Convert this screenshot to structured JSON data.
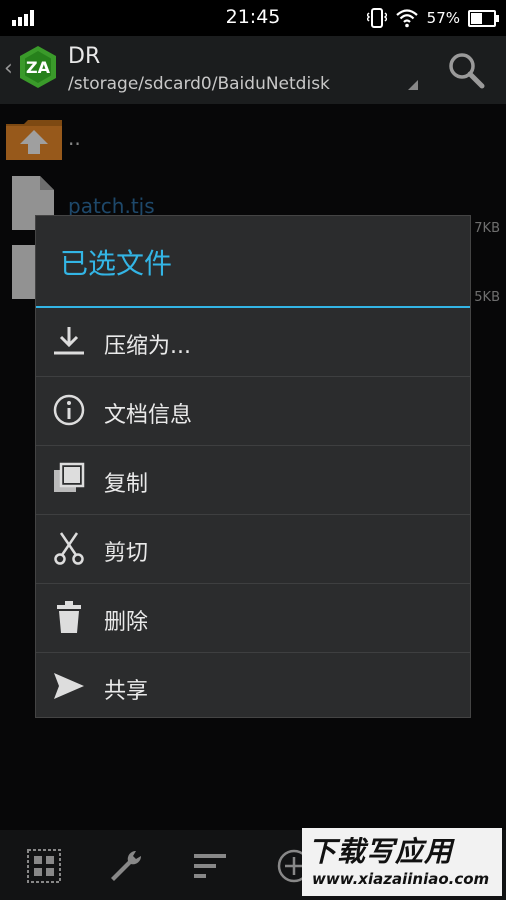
{
  "status_bar": {
    "time": "21:45",
    "battery_percent": "57%",
    "battery_level": 0.57,
    "icons": [
      "signal-icon",
      "vibrate-icon",
      "wifi-icon",
      "battery-icon"
    ]
  },
  "action_bar": {
    "title": "DR",
    "path": "/storage/sdcard0/BaiduNetdisk",
    "icons": [
      "back-chevron-icon",
      "zarchiver-logo-icon",
      "dropdown-triangle-icon",
      "search-icon"
    ]
  },
  "file_list": {
    "up_label": "..",
    "items": [
      {
        "name": "patch.tjs",
        "size": "7KB"
      },
      {
        "name": "",
        "size": "5KB"
      }
    ]
  },
  "dialog": {
    "title": "已选文件",
    "items": [
      {
        "label": "压缩为...",
        "icon": "download-icon"
      },
      {
        "label": "文档信息",
        "icon": "info-icon"
      },
      {
        "label": "复制",
        "icon": "copy-icon"
      },
      {
        "label": "剪切",
        "icon": "scissors-icon"
      },
      {
        "label": "删除",
        "icon": "trash-icon"
      },
      {
        "label": "共享",
        "icon": "send-icon"
      }
    ]
  },
  "bottom_bar": {
    "icons": [
      "grid-select-icon",
      "wrench-icon",
      "sort-icon",
      "add-icon"
    ]
  },
  "watermark": {
    "title": "下载写应用",
    "url": "www.xiazaiiniao.com"
  },
  "colors": {
    "accent": "#33b5e5",
    "dialog_bg": "#2b2c2d",
    "actionbar_bg": "#1b1d1e",
    "folder_orange": "#e8892a"
  }
}
